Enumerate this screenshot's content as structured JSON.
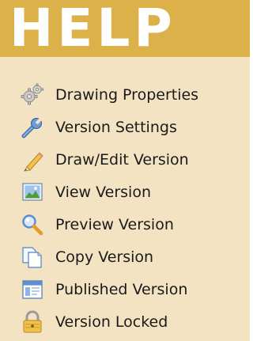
{
  "panel": {
    "title": "HELP",
    "header_color": "#ddb14a",
    "background_color": "#f3e3c2"
  },
  "items": [
    {
      "label": "Drawing Properties",
      "icon": "gears-icon"
    },
    {
      "label": "Version Settings",
      "icon": "wrench-icon"
    },
    {
      "label": "Draw/Edit Version",
      "icon": "pencil-icon"
    },
    {
      "label": "View Version",
      "icon": "landscape-picture-icon"
    },
    {
      "label": "Preview Version",
      "icon": "magnifier-icon"
    },
    {
      "label": "Copy Version",
      "icon": "copy-pages-icon"
    },
    {
      "label": "Published Version",
      "icon": "published-window-icon"
    },
    {
      "label": "Version Locked",
      "icon": "padlock-icon"
    }
  ]
}
